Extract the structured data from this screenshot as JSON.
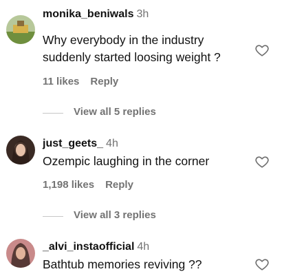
{
  "comments": [
    {
      "username": "monika_beniwals",
      "time": "3h",
      "text_lines": [
        "Why everybody in the industry",
        "suddenly started loosing weight ?"
      ],
      "likes": "11 likes",
      "reply_label": "Reply",
      "view_replies": "View all 5 replies"
    },
    {
      "username": "just_geets_",
      "time": "4h",
      "text_lines": [
        "Ozempic laughing in the corner"
      ],
      "likes": "1,198 likes",
      "reply_label": "Reply",
      "view_replies": "View all 3 replies"
    },
    {
      "username": "_alvi_instaofficial",
      "time": "4h",
      "text_lines": [
        "Bathtub memories reviving ??"
      ]
    }
  ],
  "icons": {
    "like": "heart-outline-icon"
  },
  "colors": {
    "secondary_text": "#737373",
    "divider": "#c7c7c7"
  }
}
